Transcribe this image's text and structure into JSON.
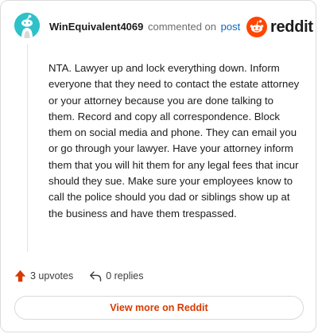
{
  "comment": {
    "author": "WinEquivalent4069",
    "action_text": "commented on",
    "post_link": "post",
    "body": "NTA. Lawyer up and lock everything down. Inform everyone that they need to contact the estate attorney or your attorney because you are done talking to them. Record and copy all correspondence. Block them on social media and phone. They can email you or go through your lawyer. Have your attorney inform them that you will hit them for any legal fees that incur should they sue. Make sure your employees know to call the police should you dad or siblings show up at the business and have them trespassed."
  },
  "brand": {
    "name": "reddit",
    "color": "#ff4500"
  },
  "stats": {
    "upvotes": "3 upvotes",
    "replies": "0 replies"
  },
  "footer": {
    "view_more": "View more on Reddit"
  },
  "colors": {
    "accent": "#d93a00",
    "avatar_bg": "#2ec1c8",
    "link": "#0a66c2"
  },
  "icons": {
    "avatar": "snoo-avatar-icon",
    "brand": "reddit-snoo-logo-icon",
    "upvote": "upvote-arrow-icon",
    "reply": "reply-arrow-icon"
  }
}
